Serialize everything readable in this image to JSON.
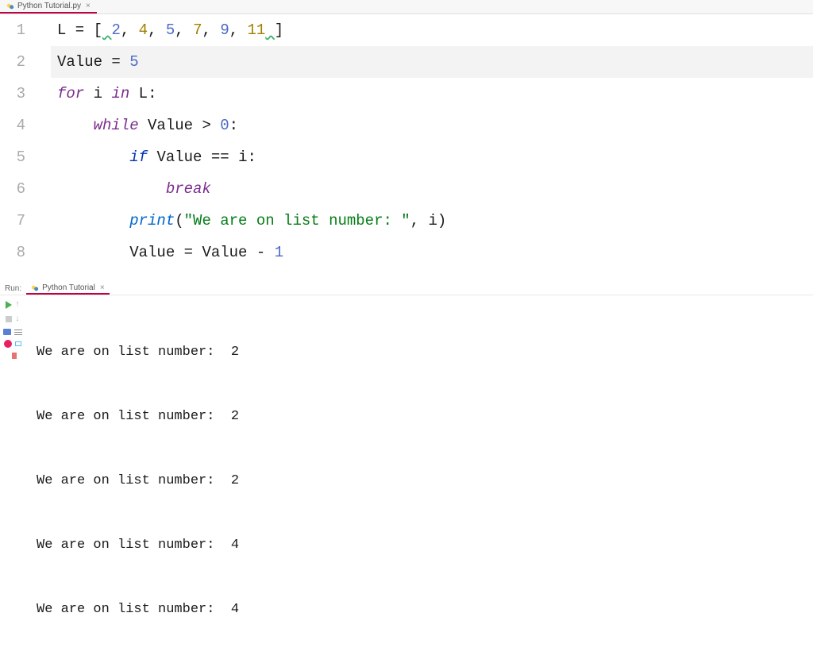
{
  "editor_tab": {
    "filename": "Python Tutorial.py",
    "close_glyph": "×"
  },
  "code": {
    "line_numbers": [
      "1",
      "2",
      "3",
      "4",
      "5",
      "6",
      "7",
      "8"
    ],
    "highlighted_line_index": 1,
    "line1": {
      "ident": "L",
      "eq": " = ",
      "brO": "[",
      "pre": " ",
      "n1": "2",
      "c1": ", ",
      "n2": "4",
      "c2": ", ",
      "n3": "5",
      "c3": ", ",
      "n4": "7",
      "c4": ", ",
      "n5": "9",
      "c5": ", ",
      "n6": "11",
      "post": " ",
      "brC": "]"
    },
    "line2": {
      "ident": "Value",
      "eq": " = ",
      "num": "5"
    },
    "line3": {
      "kw_for": "for",
      "sp1": " ",
      "var_i": "i",
      "sp2": " ",
      "kw_in": "in",
      "sp3": " ",
      "var_L": "L",
      "colon": ":"
    },
    "line4": {
      "indent": "    ",
      "kw_while": "while",
      "sp": " ",
      "var": "Value",
      "op": " > ",
      "num": "0",
      "colon": ":"
    },
    "line5": {
      "indent": "        ",
      "kw_if": "if",
      "sp": " ",
      "var": "Value",
      "op": " == ",
      "var2": "i",
      "colon": ":"
    },
    "line6": {
      "indent": "            ",
      "kw_break": "break"
    },
    "line7": {
      "indent": "        ",
      "fn": "print",
      "paren_o": "(",
      "str": "\"We are on list number: \"",
      "comma": ", ",
      "var": "i",
      "paren_c": ")"
    },
    "line8": {
      "indent": "        ",
      "var1": "Value",
      "eq": " = ",
      "var2": "Value",
      "op": " - ",
      "num": "1"
    }
  },
  "run": {
    "label": "Run:",
    "tab_name": "Python Tutorial",
    "close_glyph": "×",
    "output_lines": [
      "We are on list number:  2",
      "We are on list number:  2",
      "We are on list number:  2",
      "We are on list number:  4",
      "We are on list number:  4"
    ]
  },
  "icons": {
    "python_file": "python-file-icon"
  }
}
